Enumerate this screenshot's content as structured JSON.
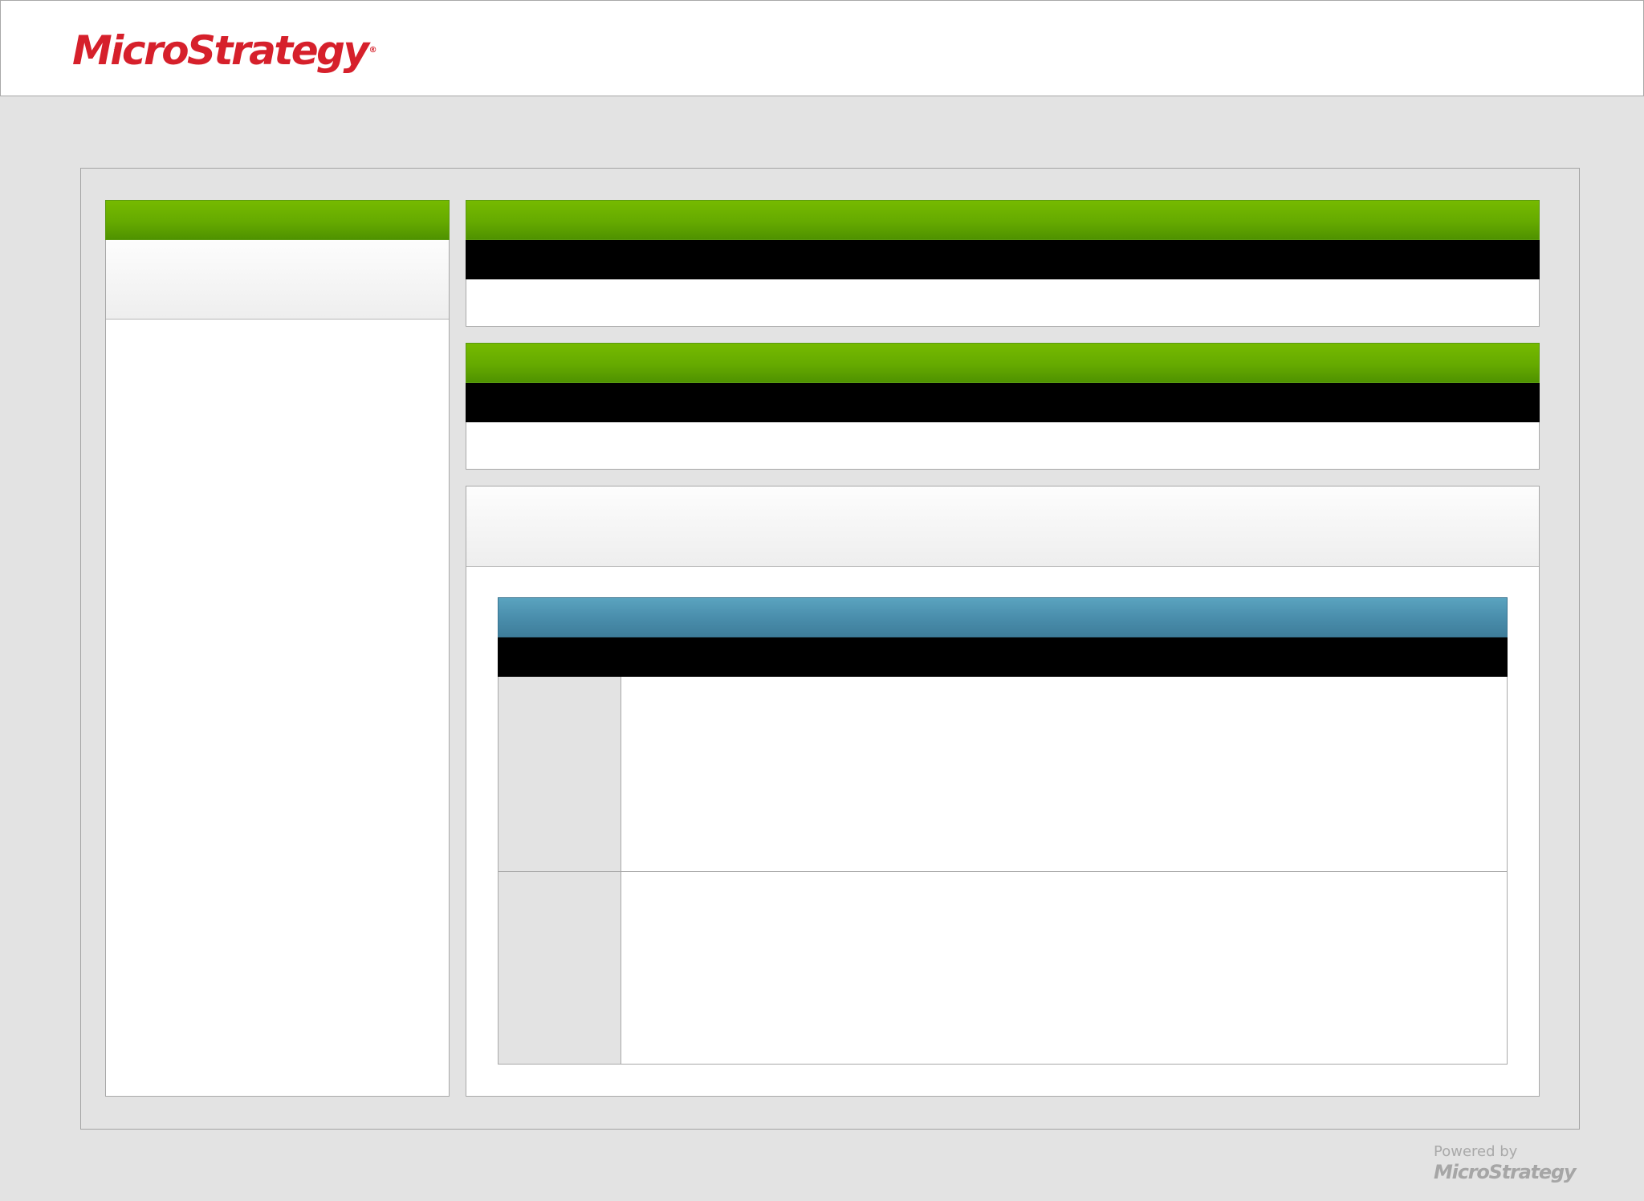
{
  "brand": {
    "logo_text": "MicroStrategy",
    "accent_red": "#d6202b",
    "header_green": "#65aa00",
    "table_header_blue": "#4a8eac"
  },
  "left_panel": {
    "title": "",
    "subtitle": ""
  },
  "kpi_panels": [
    {
      "title": "",
      "subheader": "",
      "body": ""
    },
    {
      "title": "",
      "subheader": "",
      "body": ""
    }
  ],
  "detail_panel": {
    "title": "",
    "grid": {
      "title": "",
      "header": "",
      "rows": [
        {
          "label": "",
          "value": ""
        },
        {
          "label": "",
          "value": ""
        }
      ]
    }
  },
  "footer": {
    "powered_by": "Powered by",
    "brand": "MicroStrategy"
  }
}
